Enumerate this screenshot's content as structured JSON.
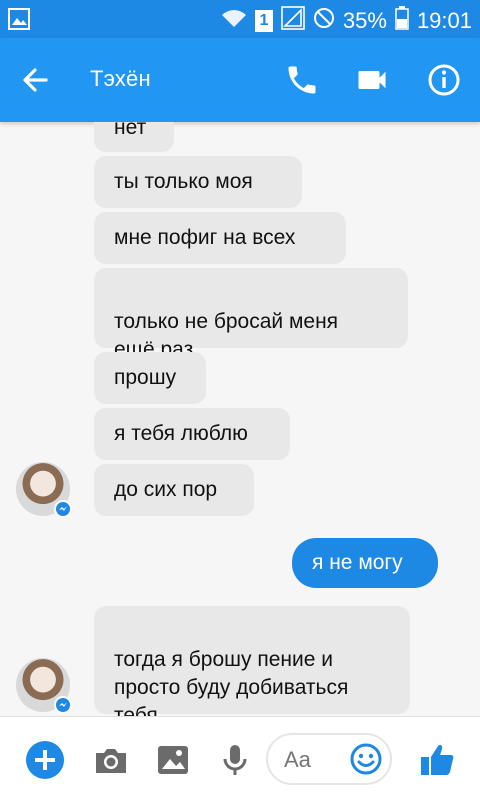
{
  "status": {
    "battery": "35%",
    "time": "19:01",
    "sim": "1"
  },
  "header": {
    "contact_name": "Тэхён"
  },
  "messages": [
    {
      "text": "нет",
      "dir": "in"
    },
    {
      "text": "ты только моя",
      "dir": "in"
    },
    {
      "text": "мне пофиг на всех",
      "dir": "in"
    },
    {
      "text": "только не бросай меня\nещё раз",
      "dir": "in"
    },
    {
      "text": "прошу",
      "dir": "in"
    },
    {
      "text": "я тебя люблю",
      "dir": "in"
    },
    {
      "text": "до сих пор",
      "dir": "in"
    },
    {
      "text": "я не могу",
      "dir": "out"
    },
    {
      "text": "тогда я брошу пение и\nпросто буду добиваться\nтебя",
      "dir": "in"
    }
  ],
  "composer": {
    "placeholder": "Aa"
  },
  "colors": {
    "brand": "#2196f3",
    "status": "#1e88e5",
    "incoming": "#e8e8e8",
    "outgoing": "#1e88e5"
  },
  "icons": {
    "header": [
      "back-arrow-icon",
      "phone-icon",
      "video-icon",
      "info-icon"
    ],
    "bottom": [
      "plus-icon",
      "camera-icon",
      "image-icon",
      "mic-icon",
      "emoji-icon",
      "like-icon"
    ]
  }
}
